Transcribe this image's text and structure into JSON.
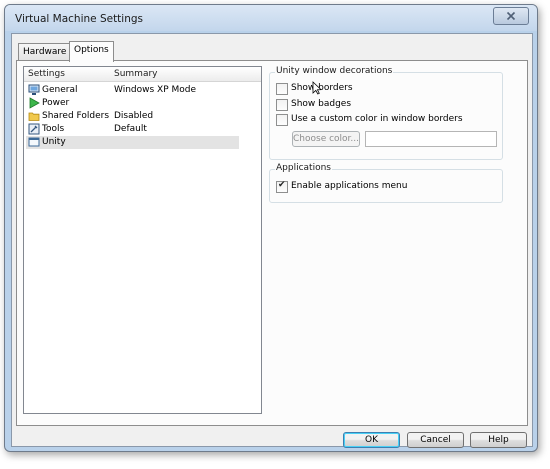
{
  "window": {
    "title": "Virtual Machine Settings"
  },
  "tabs": [
    {
      "label": "Hardware",
      "active": false
    },
    {
      "label": "Options",
      "active": true
    }
  ],
  "settings_list": {
    "columns": [
      "Settings",
      "Summary"
    ],
    "rows": [
      {
        "name": "General",
        "summary": "Windows XP Mode",
        "icon": "monitor-icon"
      },
      {
        "name": "Power",
        "summary": "",
        "icon": "play-arrow-icon"
      },
      {
        "name": "Shared Folders",
        "summary": "Disabled",
        "icon": "folder-icon"
      },
      {
        "name": "Tools",
        "summary": "Default",
        "icon": "tools-icon"
      },
      {
        "name": "Unity",
        "summary": "",
        "icon": "unity-window-icon",
        "selected": true
      }
    ]
  },
  "unity_decorations": {
    "title": "Unity window decorations",
    "show_borders": {
      "label": "Show borders",
      "checked": false
    },
    "show_badges": {
      "label": "Show badges",
      "checked": false
    },
    "custom_color": {
      "label": "Use a custom color in window borders",
      "checked": false
    },
    "choose_color_label": "Choose color..."
  },
  "applications": {
    "title": "Applications",
    "enable_menu": {
      "label": "Enable applications menu",
      "checked": true
    }
  },
  "buttons": {
    "ok": "OK",
    "cancel": "Cancel",
    "help": "Help"
  },
  "colors": {
    "window_frame": "#b9d1ea",
    "panel_bg": "#fcfcfc",
    "selected_row": "#e3e3e3",
    "default_button_glow": "#48d0f6"
  }
}
